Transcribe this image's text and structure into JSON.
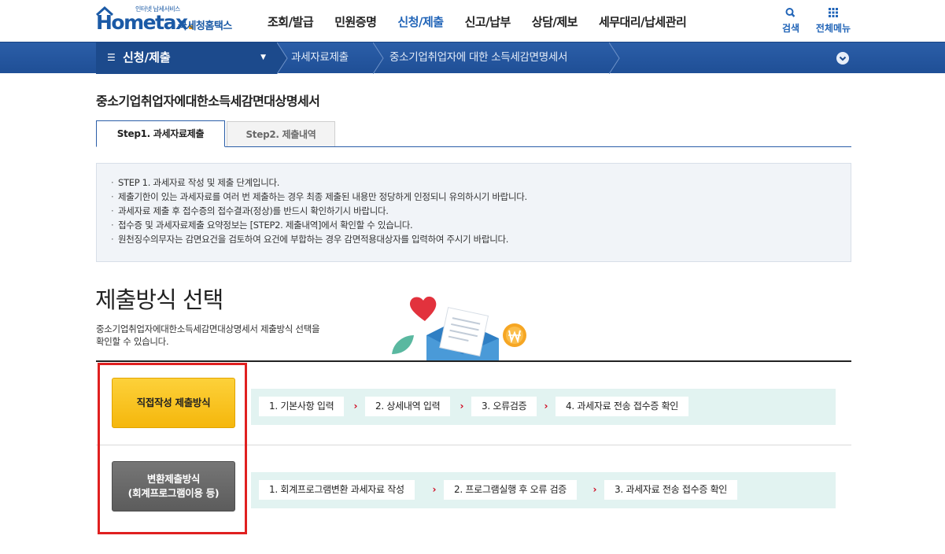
{
  "header": {
    "logo_small": "인터넷 납세서비스",
    "logo_brand_1": "Hom",
    "logo_brand_2": "e",
    "logo_brand_3": "tax",
    "logo_dot": ".",
    "logo_kor": "국세청홈택스",
    "nav": [
      "조회/발급",
      "민원증명",
      "신청/제출",
      "신고/납부",
      "상담/제보",
      "세무대리/납세관리"
    ],
    "active_nav_index": 2,
    "search_label": "검색",
    "all_menu_label": "전체메뉴"
  },
  "locbar": {
    "menu_select": "신청/제출",
    "crumbs": [
      "과세자료제출",
      "중소기업취업자에 대한 소득세감면명세서"
    ]
  },
  "page": {
    "title": "중소기업취업자에대한소득세감면대상명세서",
    "tabs": [
      "Step1. 과세자료제출",
      "Step2. 제출내역"
    ],
    "active_tab_index": 0,
    "notice": [
      "STEP 1. 과세자료 작성 및 제출 단계입니다.",
      "제출기한이 있는 과세자료를 여러 번 제출하는 경우 최종 제출된 내용만 정당하게 인정되니 유의하시기 바랍니다.",
      "과세자료 제출 후 접수증의 접수결과(정상)를 반드시 확인하기시 바랍니다.",
      "접수증 및 과세자료제출 요약정보는 [STEP2. 제출내역]에서 확인할 수 있습니다.",
      "원천징수의무자는 감면요건을 검토하여 요건에 부합하는 경우 감면적용대상자를 입력하여 주시기 바랍니다."
    ],
    "section_title": "제출방식 선택",
    "section_desc_1": "중소기업취업자에대한소득세감면대상명세서 제출방식 선택을",
    "section_desc_2": "확인할 수 있습니다."
  },
  "methods": {
    "direct": {
      "label": "직접작성 제출방식",
      "steps": [
        "1. 기본사항 입력",
        "2. 상세내역 입력",
        "3. 오류검증",
        "4. 과세자료 전송 접수증 확인"
      ]
    },
    "convert": {
      "label_1": "변환제출방식",
      "label_2": "(회계프로그램이용 등)",
      "steps": [
        "1. 회계프로그램변환 과세자료 작성",
        "2. 프로그램실행 후 오류 검증",
        "3. 과세자료 전송 접수증 확인"
      ]
    }
  },
  "colors": {
    "brand_blue": "#1b5aa6",
    "nav_active": "#2265b8",
    "locbar": "#2b5ea8",
    "direct_button": "#f9c320",
    "convert_button": "#686868",
    "flow_bg": "#e2f3f1",
    "flow_arrow": "#d0021b",
    "highlight_border": "#e02020"
  },
  "icons": [
    "search-icon",
    "grid-menu-icon",
    "hamburger-icon",
    "caret-down-icon",
    "chevron-down-circle-icon",
    "heart-icon",
    "envelope-icon",
    "document-icon",
    "leaf-icon",
    "won-coin-icon",
    "arrow-right-icon"
  ]
}
